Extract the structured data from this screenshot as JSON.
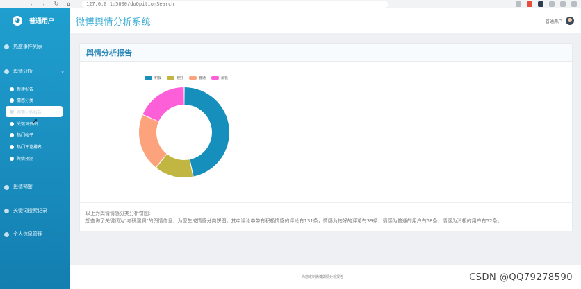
{
  "browser": {
    "url": "127.0.0.1:5000/doOpitionSearch"
  },
  "sidebar": {
    "user_label": "普通用户",
    "groups": [
      {
        "label": "热度事件列表"
      },
      {
        "label": "舆情分析"
      },
      {
        "label": "舆情预警"
      },
      {
        "label": "关键词搜索记录"
      },
      {
        "label": "个人信息管理"
      }
    ],
    "sub_items": [
      {
        "label": "新建报告"
      },
      {
        "label": "情感分类"
      },
      {
        "label": "舆情分析报告"
      },
      {
        "label": "关键词云图"
      },
      {
        "label": "热门帖子"
      },
      {
        "label": "热门评论排名"
      },
      {
        "label": "舆情预测"
      }
    ]
  },
  "header": {
    "title": "微博舆情分析系统",
    "user_label": "普通用户"
  },
  "card": {
    "title": "舆情分析报告",
    "summary_title": "以上为舆情情感分类分析饼图:",
    "summary_body": "您查询了关键词为\"考研漏洞\"的舆情信息，为您生成情感分类饼图，其中评论中带有积极情感的评论有131条，情感为较好的评论有39条，情感为普通的用户有58条，情感为消极的用户有52条。"
  },
  "chart_data": {
    "type": "pie",
    "categories": [
      "积极",
      "较好",
      "普通",
      "消极"
    ],
    "values": [
      131,
      39,
      58,
      52
    ],
    "colors": [
      "#168fbd",
      "#c1b641",
      "#fca37d",
      "#fd5fd8"
    ],
    "legend": "top",
    "donut": true
  },
  "footer": {
    "text": "为您定制微博舆情分析报告"
  },
  "watermark": "CSDN @QQ79278590"
}
